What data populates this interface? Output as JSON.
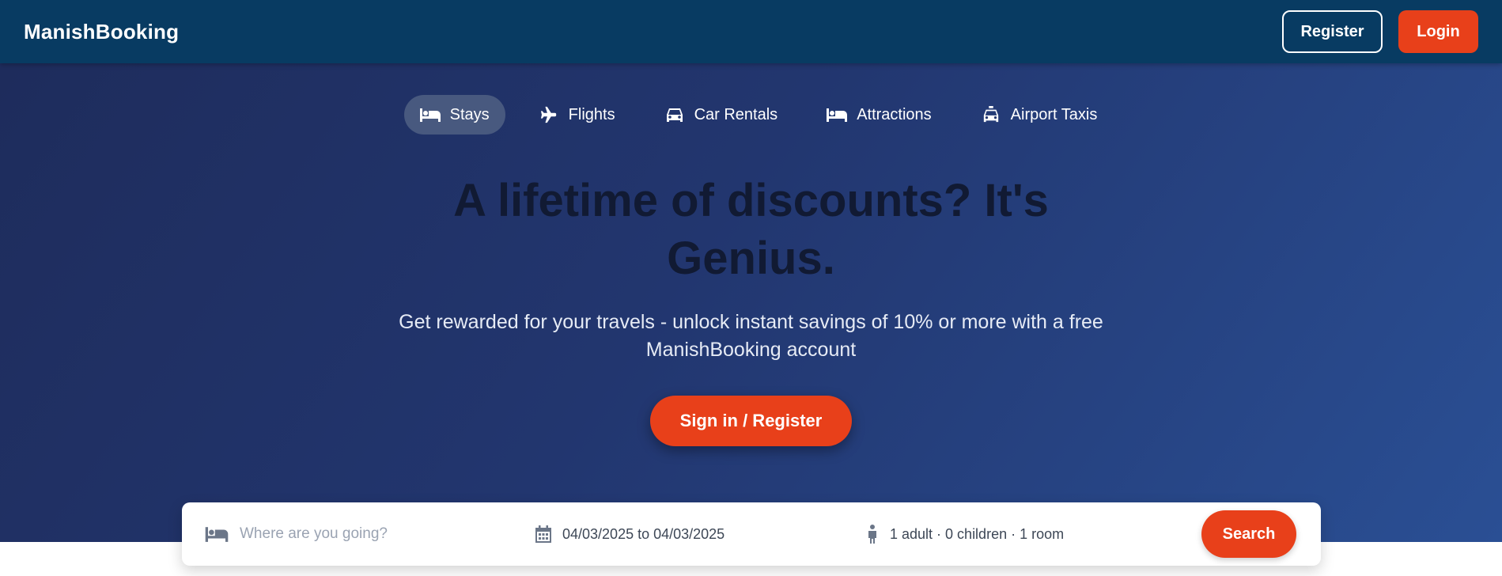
{
  "header": {
    "brand": "ManishBooking",
    "register_label": "Register",
    "login_label": "Login"
  },
  "nav": {
    "tabs": [
      {
        "label": "Stays",
        "icon": "bed-icon",
        "active": true
      },
      {
        "label": "Flights",
        "icon": "plane-icon",
        "active": false
      },
      {
        "label": "Car Rentals",
        "icon": "car-icon",
        "active": false
      },
      {
        "label": "Attractions",
        "icon": "bed-icon",
        "active": false
      },
      {
        "label": "Airport Taxis",
        "icon": "taxi-icon",
        "active": false
      }
    ]
  },
  "hero": {
    "headline_line1": "A lifetime of discounts? It's",
    "headline_line2": "Genius.",
    "subtext_line1": "Get rewarded for your travels - unlock instant savings of 10% or more with a free",
    "subtext_line2": "ManishBooking account",
    "cta_label": "Sign in / Register"
  },
  "search": {
    "destination_placeholder": "Where are you going?",
    "dates": "04/03/2025 to 04/03/2025",
    "guests": "1 adult · 0 children · 1 room",
    "button_label": "Search"
  },
  "colors": {
    "header_bg": "#083b62",
    "accent": "#e8401a",
    "hero_gradient_start": "#1e2c5c",
    "hero_gradient_end": "#2a4f94"
  }
}
